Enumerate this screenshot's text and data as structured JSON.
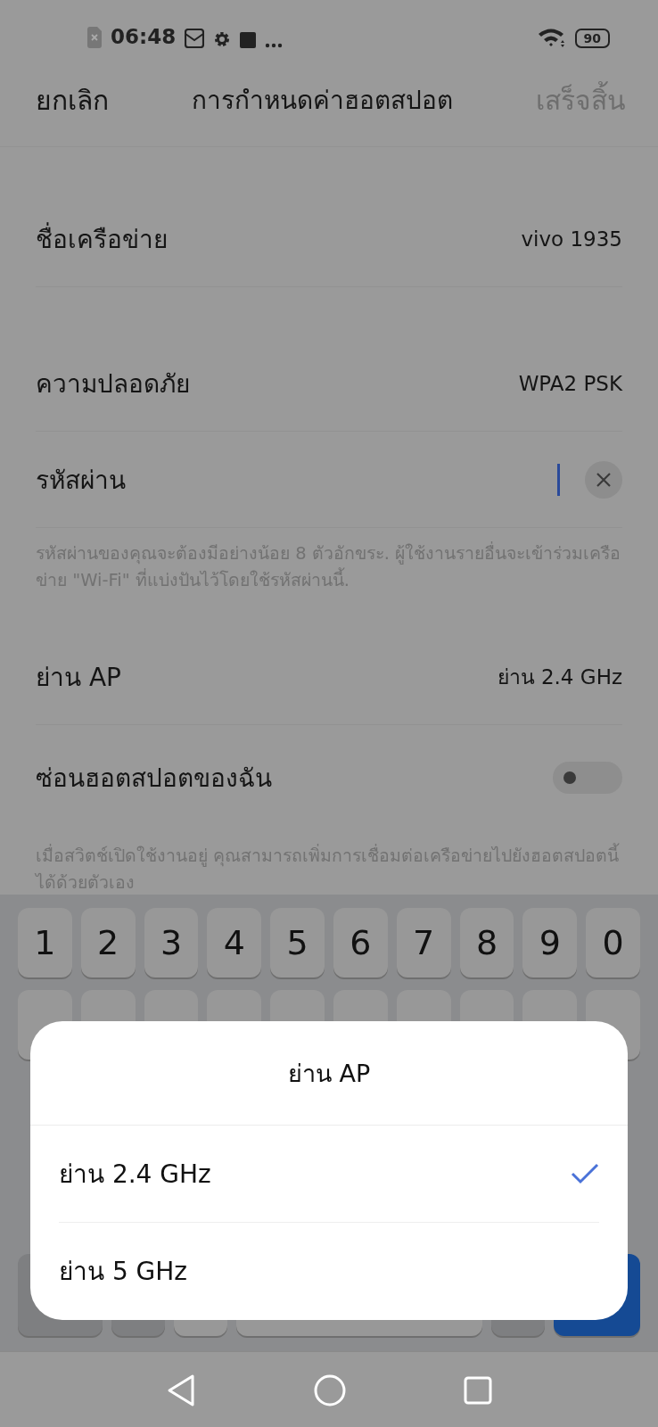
{
  "status_bar": {
    "time": "06:48",
    "battery": "90"
  },
  "header": {
    "cancel": "ยกเลิก",
    "title": "การกำหนดค่าฮอตสปอต",
    "done": "เสร็จสิ้น",
    "done_disabled": true
  },
  "sections": [
    {
      "rows": [
        {
          "kind": "value",
          "label": "ชื่อเครือข่าย",
          "value": "vivo 1935"
        }
      ]
    },
    {
      "rows": [
        {
          "kind": "value",
          "label": "ความปลอดภัย",
          "value": "WPA2 PSK"
        },
        {
          "kind": "password",
          "label": "รหัสผ่าน"
        },
        {
          "kind": "hint",
          "text": "รหัสผ่านของคุณจะต้องมีอย่างน้อย 8 ตัวอักขระ. ผู้ใช้งานรายอื่นจะเข้าร่วมเครือข่าย \"Wi-Fi\" ที่แบ่งปันไว้โดยใช้รหัสผ่านนี้."
        }
      ]
    },
    {
      "rows": [
        {
          "kind": "value",
          "label": "ย่าน AP",
          "value": "ย่าน 2.4 GHz"
        },
        {
          "kind": "toggle",
          "label": "ซ่อนฮอตสปอตของฉัน",
          "on": false
        },
        {
          "kind": "hint",
          "text": "เมื่อสวิตช์เปิดใช้งานอยู่ คุณสามารถเพิ่มการเชื่อมต่อเครือข่ายไปยังฮอตสปอตนี้ได้ด้วยตัวเอง"
        }
      ]
    }
  ],
  "keyboard": {
    "number_row": [
      "1",
      "2",
      "3",
      "4",
      "5",
      "6",
      "7",
      "8",
      "9",
      "0"
    ]
  },
  "dialog": {
    "title": "ย่าน AP",
    "options": [
      {
        "label": "ย่าน 2.4 GHz",
        "selected": true
      },
      {
        "label": "ย่าน 5 GHz",
        "selected": false
      }
    ]
  }
}
